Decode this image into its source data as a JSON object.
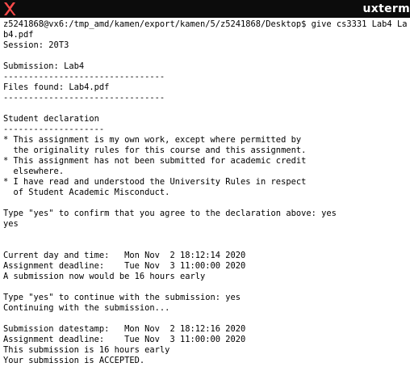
{
  "window": {
    "title": "uxterm",
    "icon": "x-logo-icon"
  },
  "terminal": {
    "lines": [
      "z5241868@vx6:/tmp_amd/kamen/export/kamen/5/z5241868/Desktop$ give cs3331 Lab4 La",
      "b4.pdf",
      "Session: 20T3",
      "",
      "Submission: Lab4",
      "--------------------------------",
      "Files found: Lab4.pdf",
      "--------------------------------",
      "",
      "Student declaration",
      "--------------------",
      "* This assignment is my own work, except where permitted by",
      "  the originality rules for this course and this assignment.",
      "* This assignment has not been submitted for academic credit",
      "  elsewhere.",
      "* I have read and understood the University Rules in respect",
      "  of Student Academic Misconduct.",
      "",
      "Type \"yes\" to confirm that you agree to the declaration above: yes",
      "yes",
      "",
      "",
      "Current day and time:   Mon Nov  2 18:12:14 2020",
      "Assignment deadline:    Tue Nov  3 11:00:00 2020",
      "A submission now would be 16 hours early",
      "",
      "Type \"yes\" to continue with the submission: yes",
      "Continuing with the submission...",
      "",
      "Submission datestamp:   Mon Nov  2 18:12:16 2020",
      "Assignment deadline:    Tue Nov  3 11:00:00 2020",
      "This submission is 16 hours early",
      "Your submission is ACCEPTED."
    ]
  }
}
